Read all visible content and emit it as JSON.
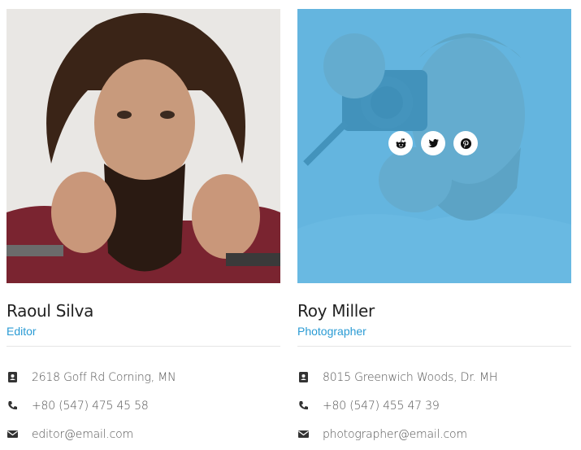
{
  "colors": {
    "accent": "#2a9bd4",
    "overlay": "#4aacde",
    "text": "#222222",
    "muted": "#555555"
  },
  "members": [
    {
      "name": "Raoul Silva",
      "role": "Editor",
      "address": "2618 Goff Rd Corning, MN",
      "phone": "+80 (547) 475 45 58",
      "email": "editor@email.com",
      "photo_description": "long-haired bearded man twirling mustache"
    },
    {
      "name": "Roy Miller",
      "role": "Photographer",
      "address": "8015 Greenwich Woods, Dr. MH",
      "phone": "+80 (547) 455 47 39",
      "email": "photographer@email.com",
      "photo_description": "bearded man holding camera",
      "socials": [
        "reddit-icon",
        "twitter-icon",
        "pinterest-icon"
      ]
    }
  ]
}
